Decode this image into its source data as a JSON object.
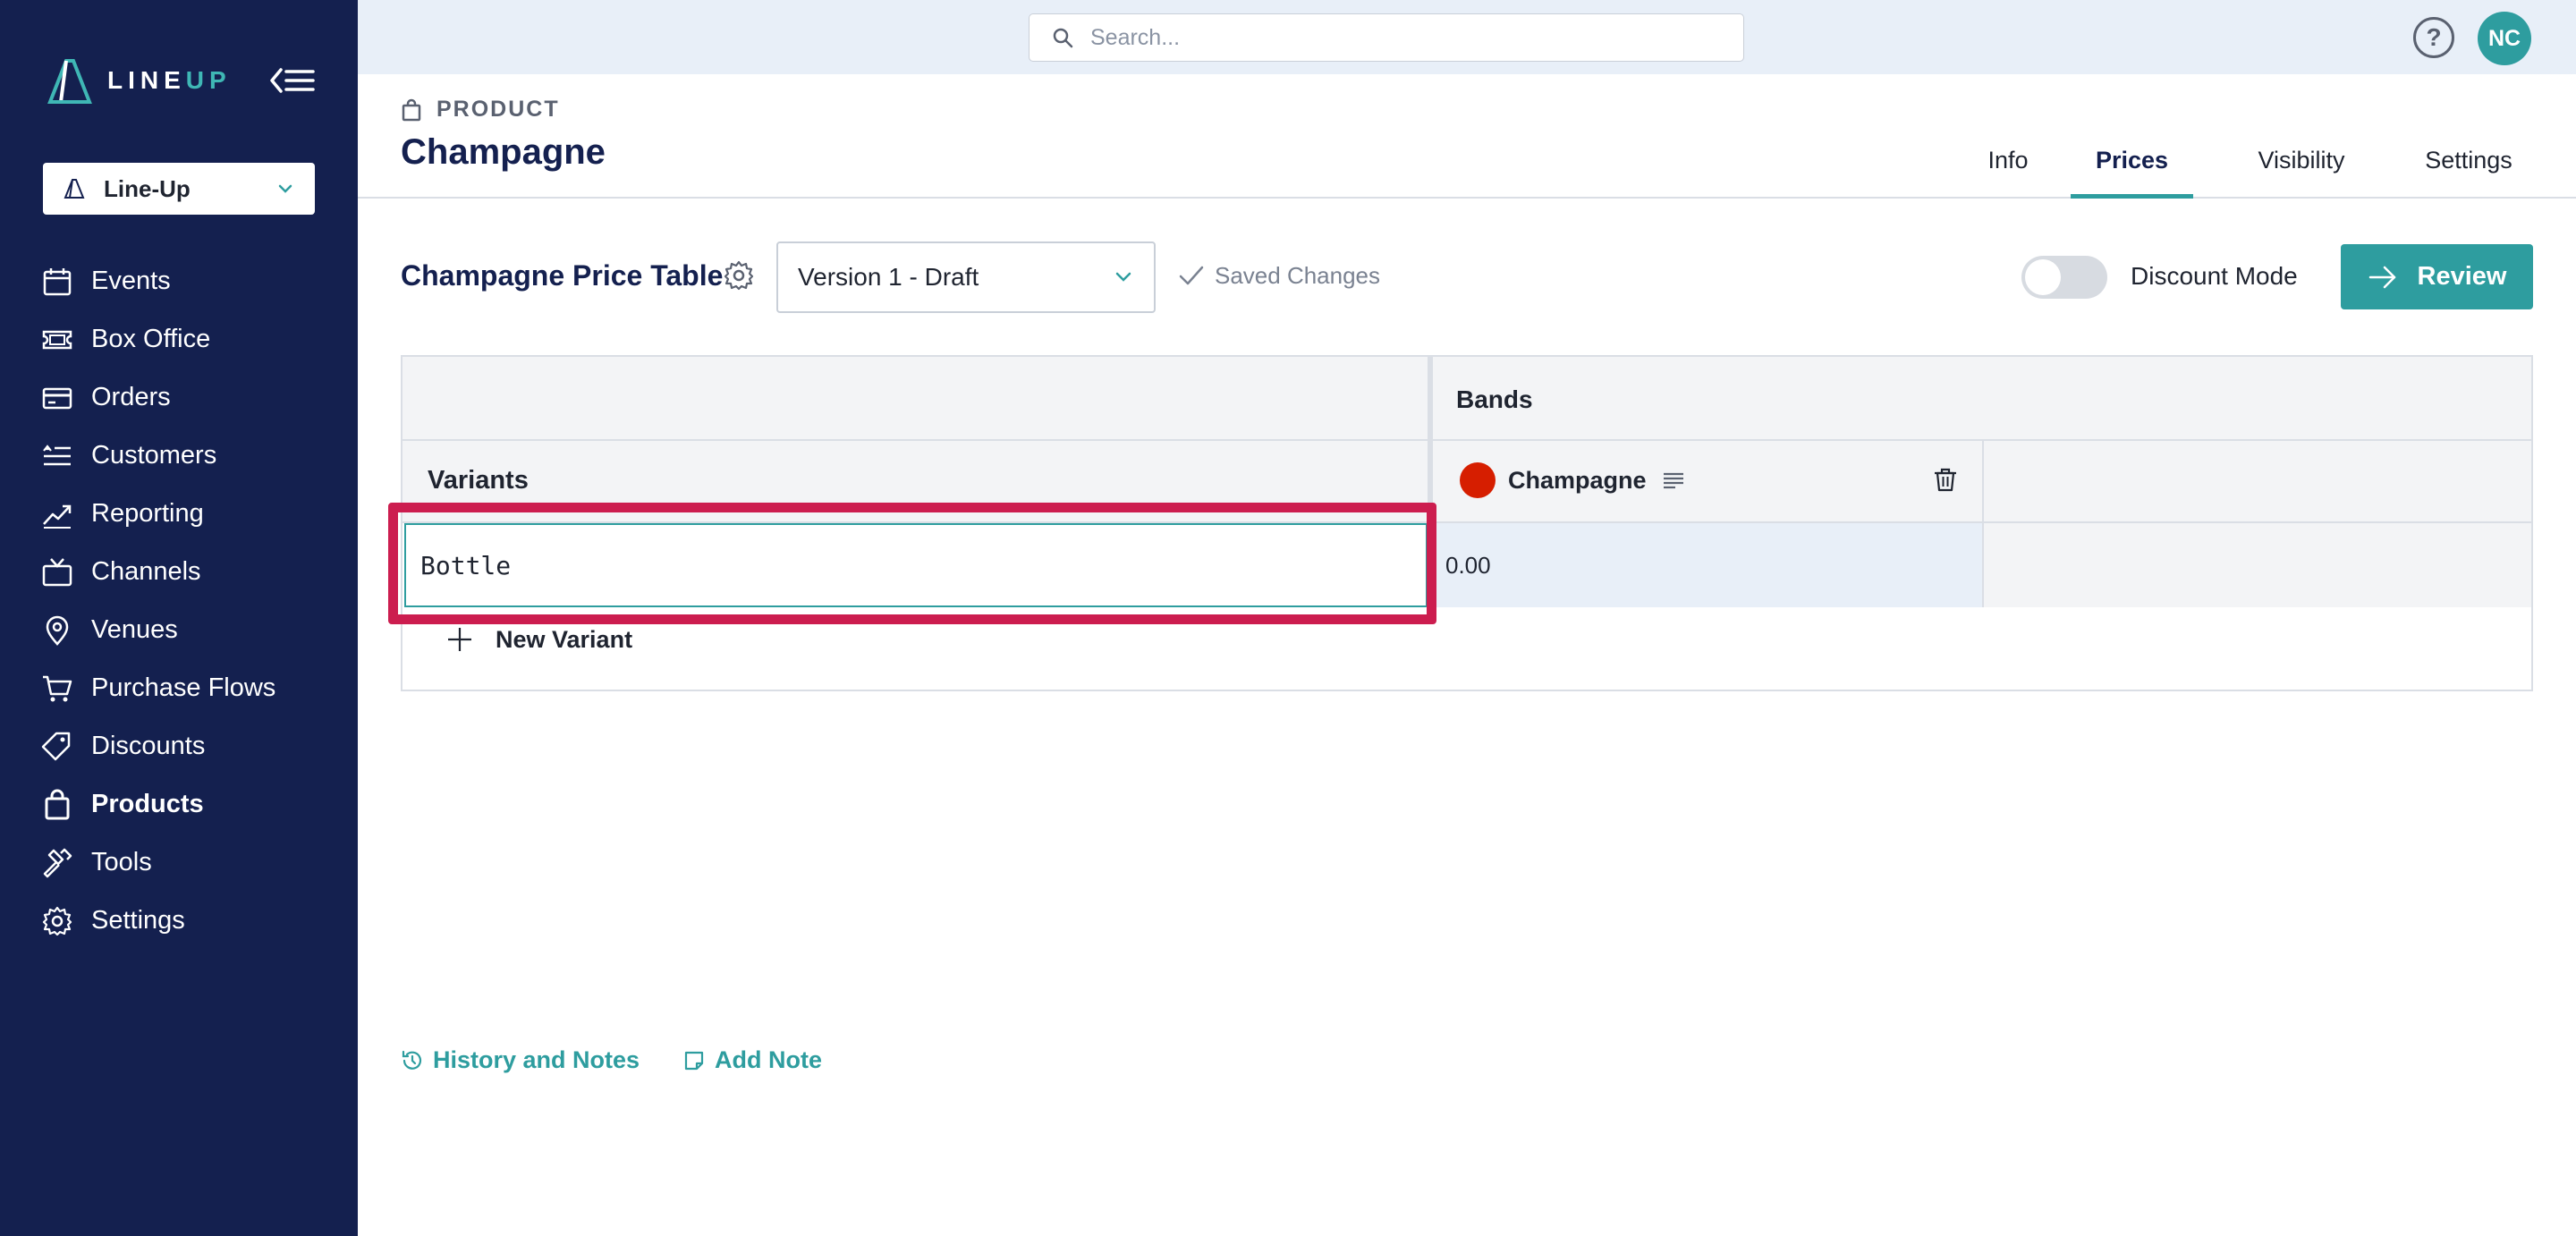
{
  "brand": {
    "logo_text_a": "LINE",
    "logo_text_b": "UP",
    "accent": "#2e9d9f",
    "sidebar_bg": "#14204f"
  },
  "sidebar": {
    "org_selector": {
      "label": "Line-Up",
      "icon": "lineup-mark-icon"
    },
    "items": [
      {
        "label": "Events",
        "icon": "calendar-icon",
        "active": false
      },
      {
        "label": "Box Office",
        "icon": "ticket-icon",
        "active": false
      },
      {
        "label": "Orders",
        "icon": "credit-card-icon",
        "active": false
      },
      {
        "label": "Customers",
        "icon": "customers-list-icon",
        "active": false
      },
      {
        "label": "Reporting",
        "icon": "trend-chart-icon",
        "active": false
      },
      {
        "label": "Channels",
        "icon": "tv-icon",
        "active": false
      },
      {
        "label": "Venues",
        "icon": "map-pin-icon",
        "active": false
      },
      {
        "label": "Purchase Flows",
        "icon": "cart-icon",
        "active": false
      },
      {
        "label": "Discounts",
        "icon": "tags-icon",
        "active": false
      },
      {
        "label": "Products",
        "icon": "shopping-bag-icon",
        "active": true
      },
      {
        "label": "Tools",
        "icon": "hammer-icon",
        "active": false
      },
      {
        "label": "Settings",
        "icon": "gear-icon",
        "active": false
      }
    ]
  },
  "topbar": {
    "search": {
      "placeholder": "Search...",
      "value": ""
    },
    "help_icon": "?",
    "user_initials": "NC"
  },
  "header": {
    "entity_type": "PRODUCT",
    "title": "Champagne",
    "tabs": [
      {
        "label": "Info",
        "active": false
      },
      {
        "label": "Prices",
        "active": true
      },
      {
        "label": "Visibility",
        "active": false
      },
      {
        "label": "Settings",
        "active": false
      }
    ]
  },
  "toolbar": {
    "table_title": "Champagne Price Table",
    "version": "Version 1 - Draft",
    "saved_status": "Saved Changes",
    "discount_mode": {
      "label": "Discount Mode",
      "enabled": false
    },
    "review_label": "Review"
  },
  "price_table": {
    "bands_header": "Bands",
    "variants_header": "Variants",
    "bands": [
      {
        "name": "Champagne",
        "color": "#d61e00"
      }
    ],
    "rows": [
      {
        "variant": "Bottle",
        "prices": [
          "0.00"
        ]
      }
    ],
    "new_variant_label": "New Variant",
    "highlight_color": "#cc1d4f"
  },
  "footer_links": {
    "history": "History and Notes",
    "add_note": "Add Note"
  }
}
